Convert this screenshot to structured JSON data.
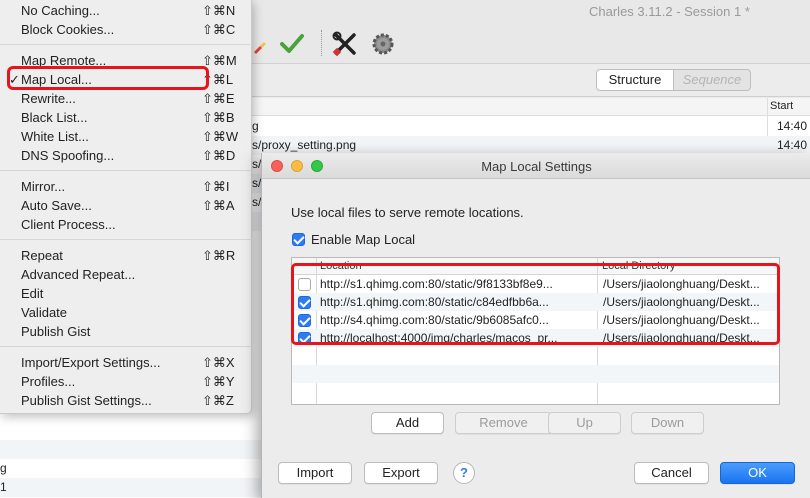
{
  "window": {
    "title": "Charles 3.11.2 - Session 1 *"
  },
  "tabs": {
    "structure": "Structure",
    "sequence": "Sequence"
  },
  "session_list": {
    "start_header": "Start",
    "rows": [
      {
        "path": "g",
        "start": "14:40"
      },
      {
        "path": "s/proxy_setting.png",
        "start": "14:40"
      }
    ],
    "fragments": [
      "s/",
      "s/",
      "s/",
      "s/",
      "s/"
    ],
    "bottom_fragments": [
      "g",
      "1"
    ]
  },
  "menu": {
    "items": [
      {
        "label": "No Caching...",
        "shortcut": "⇧⌘N"
      },
      {
        "label": "Block Cookies...",
        "shortcut": "⇧⌘C"
      },
      {
        "label": "Map Remote...",
        "shortcut": "⇧⌘M"
      },
      {
        "label": "Map Local...",
        "shortcut": "⇧⌘L",
        "checked": true,
        "check": "✓"
      },
      {
        "label": "Rewrite...",
        "shortcut": "⇧⌘E"
      },
      {
        "label": "Black List...",
        "shortcut": "⇧⌘B"
      },
      {
        "label": "White List...",
        "shortcut": "⇧⌘W"
      },
      {
        "label": "DNS Spoofing...",
        "shortcut": "⇧⌘D"
      },
      {
        "label": "Mirror...",
        "shortcut": "⇧⌘I"
      },
      {
        "label": "Auto Save...",
        "shortcut": "⇧⌘A"
      },
      {
        "label": "Client Process...",
        "shortcut": ""
      },
      {
        "label": "Repeat",
        "shortcut": "⇧⌘R"
      },
      {
        "label": "Advanced Repeat...",
        "shortcut": ""
      },
      {
        "label": "Edit",
        "shortcut": ""
      },
      {
        "label": "Validate",
        "shortcut": ""
      },
      {
        "label": "Publish Gist",
        "shortcut": ""
      },
      {
        "label": "Import/Export Settings...",
        "shortcut": "⇧⌘X"
      },
      {
        "label": "Profiles...",
        "shortcut": "⇧⌘Y"
      },
      {
        "label": "Publish Gist Settings...",
        "shortcut": "⇧⌘Z"
      }
    ]
  },
  "dialog": {
    "title": "Map Local Settings",
    "intro": "Use local files to serve remote locations.",
    "enable_label": "Enable Map Local",
    "enabled": true,
    "columns": {
      "location": "Location",
      "local_directory": "Local Directory"
    },
    "rows": [
      {
        "enabled": false,
        "location": "http://s1.qhimg.com:80/static/9f8133bf8e9...",
        "local_directory": "/Users/jiaolonghuang/Deskt..."
      },
      {
        "enabled": true,
        "location": "http://s1.qhimg.com:80/static/c84edfbb6a...",
        "local_directory": "/Users/jiaolonghuang/Deskt..."
      },
      {
        "enabled": true,
        "location": "http://s4.qhimg.com:80/static/9b6085afc0...",
        "local_directory": "/Users/jiaolonghuang/Deskt..."
      },
      {
        "enabled": true,
        "location": "http://localhost:4000/img/charles/macos_pr...",
        "local_directory": "/Users/jiaolonghuang/Deskt..."
      }
    ],
    "buttons": {
      "add": "Add",
      "remove": "Remove",
      "up": "Up",
      "down": "Down",
      "import": "Import",
      "export": "Export",
      "help": "?",
      "cancel": "Cancel",
      "ok": "OK"
    }
  },
  "colors": {
    "highlight": "#e8141b",
    "accent": "#1a74f2"
  },
  "icons": [
    "pencil-icon",
    "checkmark-icon",
    "tools-icon",
    "gear-icon"
  ]
}
